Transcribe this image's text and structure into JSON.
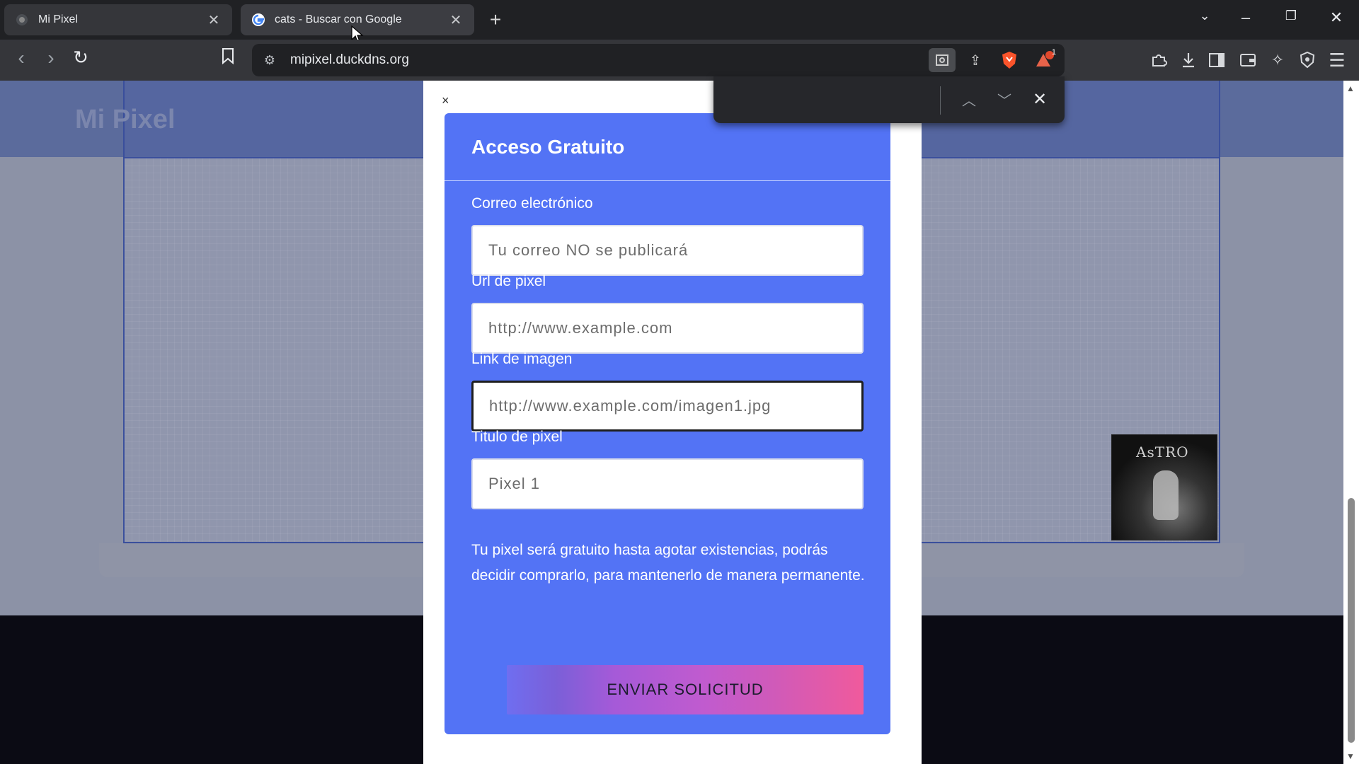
{
  "tabs": [
    {
      "title": "Mi Pixel",
      "icon": "globe-icon"
    },
    {
      "title": "cats - Buscar con Google",
      "icon": "google-icon"
    }
  ],
  "address_bar": {
    "url": "mipixel.duckdns.org"
  },
  "page": {
    "brand": "Mi Pixel",
    "thumbnail_text": "AsTRO"
  },
  "modal": {
    "close_label": "×",
    "form_title": "Acceso Gratuito",
    "fields": [
      {
        "label": "Correo electrónico",
        "placeholder": "Tu correo NO se publicará"
      },
      {
        "label": "Url de pixel",
        "placeholder": "http://www.example.com"
      },
      {
        "label": "Link de imagen",
        "placeholder": "http://www.example.com/imagen1.jpg"
      },
      {
        "label": "Titulo de pixel",
        "placeholder": "Pixel 1"
      }
    ],
    "notice": "Tu pixel será gratuito hasta agotar existencias, podrás decidir comprarlo, para mantenerlo de manera permanente.",
    "submit_label": "ENVIAR SOLICITUD"
  },
  "extensions": {
    "brave_shields_count": "1"
  },
  "colors": {
    "form_bg": "#5373f5",
    "chrome_dark": "#202124",
    "submit_gradient_start": "#6f6ef0",
    "submit_gradient_end": "#f05a9c"
  }
}
